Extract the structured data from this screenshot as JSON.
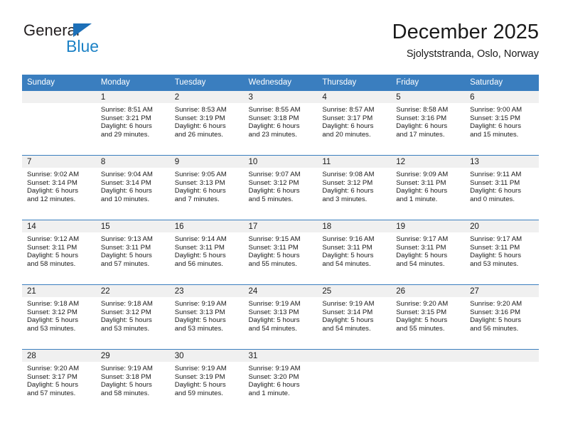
{
  "logo": {
    "word1": "General",
    "word2": "Blue",
    "triangle_color": "#1d70b8",
    "word2_color": "#1d82c6"
  },
  "header": {
    "title": "December 2025",
    "subtitle": "Sjolyststranda, Oslo, Norway"
  },
  "theme": {
    "header_band": "#3a7ebf",
    "daynum_band": "#f0f0f0",
    "text": "#1a1a1a"
  },
  "weekday_headers": [
    "Sunday",
    "Monday",
    "Tuesday",
    "Wednesday",
    "Thursday",
    "Friday",
    "Saturday"
  ],
  "weeks": [
    [
      {
        "day": "",
        "lines": []
      },
      {
        "day": "1",
        "lines": [
          "Sunrise: 8:51 AM",
          "Sunset: 3:21 PM",
          "Daylight: 6 hours",
          "and 29 minutes."
        ]
      },
      {
        "day": "2",
        "lines": [
          "Sunrise: 8:53 AM",
          "Sunset: 3:19 PM",
          "Daylight: 6 hours",
          "and 26 minutes."
        ]
      },
      {
        "day": "3",
        "lines": [
          "Sunrise: 8:55 AM",
          "Sunset: 3:18 PM",
          "Daylight: 6 hours",
          "and 23 minutes."
        ]
      },
      {
        "day": "4",
        "lines": [
          "Sunrise: 8:57 AM",
          "Sunset: 3:17 PM",
          "Daylight: 6 hours",
          "and 20 minutes."
        ]
      },
      {
        "day": "5",
        "lines": [
          "Sunrise: 8:58 AM",
          "Sunset: 3:16 PM",
          "Daylight: 6 hours",
          "and 17 minutes."
        ]
      },
      {
        "day": "6",
        "lines": [
          "Sunrise: 9:00 AM",
          "Sunset: 3:15 PM",
          "Daylight: 6 hours",
          "and 15 minutes."
        ]
      }
    ],
    [
      {
        "day": "7",
        "lines": [
          "Sunrise: 9:02 AM",
          "Sunset: 3:14 PM",
          "Daylight: 6 hours",
          "and 12 minutes."
        ]
      },
      {
        "day": "8",
        "lines": [
          "Sunrise: 9:04 AM",
          "Sunset: 3:14 PM",
          "Daylight: 6 hours",
          "and 10 minutes."
        ]
      },
      {
        "day": "9",
        "lines": [
          "Sunrise: 9:05 AM",
          "Sunset: 3:13 PM",
          "Daylight: 6 hours",
          "and 7 minutes."
        ]
      },
      {
        "day": "10",
        "lines": [
          "Sunrise: 9:07 AM",
          "Sunset: 3:12 PM",
          "Daylight: 6 hours",
          "and 5 minutes."
        ]
      },
      {
        "day": "11",
        "lines": [
          "Sunrise: 9:08 AM",
          "Sunset: 3:12 PM",
          "Daylight: 6 hours",
          "and 3 minutes."
        ]
      },
      {
        "day": "12",
        "lines": [
          "Sunrise: 9:09 AM",
          "Sunset: 3:11 PM",
          "Daylight: 6 hours",
          "and 1 minute."
        ]
      },
      {
        "day": "13",
        "lines": [
          "Sunrise: 9:11 AM",
          "Sunset: 3:11 PM",
          "Daylight: 6 hours",
          "and 0 minutes."
        ]
      }
    ],
    [
      {
        "day": "14",
        "lines": [
          "Sunrise: 9:12 AM",
          "Sunset: 3:11 PM",
          "Daylight: 5 hours",
          "and 58 minutes."
        ]
      },
      {
        "day": "15",
        "lines": [
          "Sunrise: 9:13 AM",
          "Sunset: 3:11 PM",
          "Daylight: 5 hours",
          "and 57 minutes."
        ]
      },
      {
        "day": "16",
        "lines": [
          "Sunrise: 9:14 AM",
          "Sunset: 3:11 PM",
          "Daylight: 5 hours",
          "and 56 minutes."
        ]
      },
      {
        "day": "17",
        "lines": [
          "Sunrise: 9:15 AM",
          "Sunset: 3:11 PM",
          "Daylight: 5 hours",
          "and 55 minutes."
        ]
      },
      {
        "day": "18",
        "lines": [
          "Sunrise: 9:16 AM",
          "Sunset: 3:11 PM",
          "Daylight: 5 hours",
          "and 54 minutes."
        ]
      },
      {
        "day": "19",
        "lines": [
          "Sunrise: 9:17 AM",
          "Sunset: 3:11 PM",
          "Daylight: 5 hours",
          "and 54 minutes."
        ]
      },
      {
        "day": "20",
        "lines": [
          "Sunrise: 9:17 AM",
          "Sunset: 3:11 PM",
          "Daylight: 5 hours",
          "and 53 minutes."
        ]
      }
    ],
    [
      {
        "day": "21",
        "lines": [
          "Sunrise: 9:18 AM",
          "Sunset: 3:12 PM",
          "Daylight: 5 hours",
          "and 53 minutes."
        ]
      },
      {
        "day": "22",
        "lines": [
          "Sunrise: 9:18 AM",
          "Sunset: 3:12 PM",
          "Daylight: 5 hours",
          "and 53 minutes."
        ]
      },
      {
        "day": "23",
        "lines": [
          "Sunrise: 9:19 AM",
          "Sunset: 3:13 PM",
          "Daylight: 5 hours",
          "and 53 minutes."
        ]
      },
      {
        "day": "24",
        "lines": [
          "Sunrise: 9:19 AM",
          "Sunset: 3:13 PM",
          "Daylight: 5 hours",
          "and 54 minutes."
        ]
      },
      {
        "day": "25",
        "lines": [
          "Sunrise: 9:19 AM",
          "Sunset: 3:14 PM",
          "Daylight: 5 hours",
          "and 54 minutes."
        ]
      },
      {
        "day": "26",
        "lines": [
          "Sunrise: 9:20 AM",
          "Sunset: 3:15 PM",
          "Daylight: 5 hours",
          "and 55 minutes."
        ]
      },
      {
        "day": "27",
        "lines": [
          "Sunrise: 9:20 AM",
          "Sunset: 3:16 PM",
          "Daylight: 5 hours",
          "and 56 minutes."
        ]
      }
    ],
    [
      {
        "day": "28",
        "lines": [
          "Sunrise: 9:20 AM",
          "Sunset: 3:17 PM",
          "Daylight: 5 hours",
          "and 57 minutes."
        ]
      },
      {
        "day": "29",
        "lines": [
          "Sunrise: 9:19 AM",
          "Sunset: 3:18 PM",
          "Daylight: 5 hours",
          "and 58 minutes."
        ]
      },
      {
        "day": "30",
        "lines": [
          "Sunrise: 9:19 AM",
          "Sunset: 3:19 PM",
          "Daylight: 5 hours",
          "and 59 minutes."
        ]
      },
      {
        "day": "31",
        "lines": [
          "Sunrise: 9:19 AM",
          "Sunset: 3:20 PM",
          "Daylight: 6 hours",
          "and 1 minute."
        ]
      },
      {
        "day": "",
        "lines": []
      },
      {
        "day": "",
        "lines": []
      },
      {
        "day": "",
        "lines": []
      }
    ]
  ]
}
